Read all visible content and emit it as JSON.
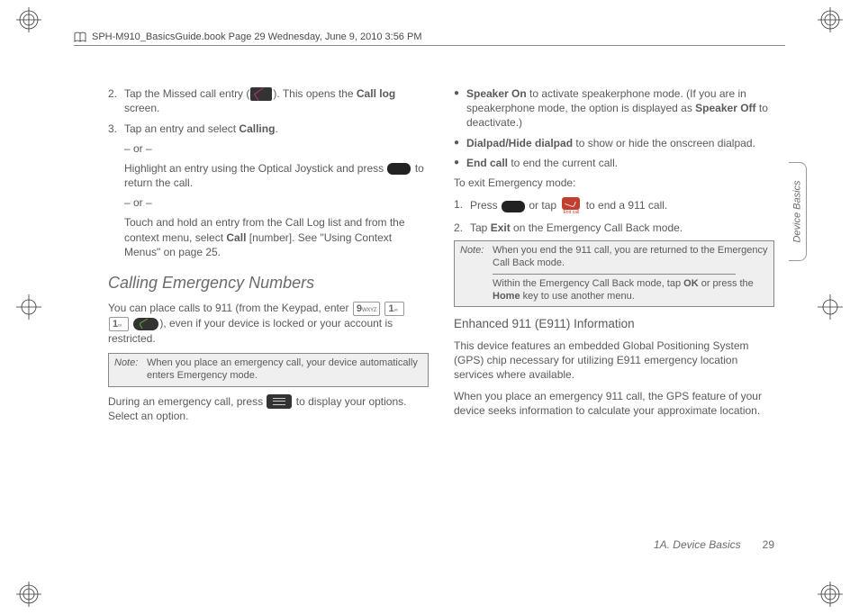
{
  "header": {
    "text": "SPH-M910_BasicsGuide.book  Page 29  Wednesday, June 9, 2010  3:56 PM"
  },
  "side_tab": "Device Basics",
  "footer": {
    "section": "1A. Device Basics",
    "page": "29"
  },
  "left": {
    "step2_a": "Tap the Missed call entry (",
    "step2_b": "). This opens the ",
    "step2_bold": "Call log",
    "step2_c": " screen.",
    "step3_a": "Tap an entry and select ",
    "step3_bold": "Calling",
    "step3_b": ".",
    "or": "– or –",
    "hl_a": "Highlight an entry using the Optical Joystick and press ",
    "hl_b": " to return the call.",
    "touch_a": "Touch and hold an entry from the Call Log list and from the context menu, select ",
    "touch_bold": "Call",
    "touch_b": " [number]. See \"Using Context Menus\" on page 25.",
    "h2": "Calling Emergency Numbers",
    "p1_a": "You can place calls to 911 (from the Keypad, enter ",
    "p1_b": "), even if your device is locked or your account is restricted.",
    "key9": {
      "big": "9",
      "small": "WXYZ"
    },
    "key1a": {
      "big": "1",
      "small": "∞"
    },
    "key1b": {
      "big": "1",
      "small": "∞"
    },
    "note1_label": "Note:",
    "note1": "When you place an emergency call, your device automatically enters Emergency mode.",
    "p2_a": "During an emergency call, press ",
    "p2_b": " to display your options. Select an option."
  },
  "right": {
    "b1_bold": "Speaker On",
    "b1_a": " to activate speakerphone mode. (If you are in speakerphone mode, the option is displayed as ",
    "b1_bold2": "Speaker Off",
    "b1_b": " to deactivate.)",
    "b2_bold": "Dialpad/Hide dialpad",
    "b2_a": " to show or hide the onscreen dialpad.",
    "b3_bold": "End call",
    "b3_a": " to end the current call.",
    "exit_h": "To exit Emergency mode:",
    "s1_a": "Press ",
    "s1_b": " or tap ",
    "s1_c": " to end a 911 call.",
    "endcall_label": "End call",
    "s2_a": "Tap ",
    "s2_bold": "Exit",
    "s2_b": " on the Emergency Call Back mode.",
    "note2_label": "Note:",
    "note2a": "When you end the 911 call, you are returned to the Emergency Call Back mode.",
    "note2b_a": "Within the Emergency Call Back mode, tap ",
    "note2b_bold": "OK",
    "note2b_b": " or press the ",
    "note2b_bold2": "Home",
    "note2b_c": " key to use another menu.",
    "h3": "Enhanced 911 (E911) Information",
    "p3": "This device features an embedded Global Positioning System (GPS) chip necessary for utilizing E911 emergency location services where available.",
    "p4": "When you place an emergency 911 call, the GPS feature of your device seeks information to calculate your approximate location."
  }
}
